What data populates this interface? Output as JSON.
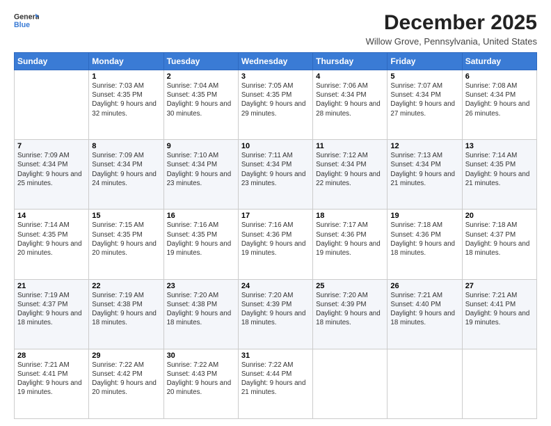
{
  "header": {
    "logo_general": "General",
    "logo_blue": "Blue",
    "month_title": "December 2025",
    "location": "Willow Grove, Pennsylvania, United States"
  },
  "days_of_week": [
    "Sunday",
    "Monday",
    "Tuesday",
    "Wednesday",
    "Thursday",
    "Friday",
    "Saturday"
  ],
  "weeks": [
    [
      {
        "day": "",
        "sunrise": "",
        "sunset": "",
        "daylight": ""
      },
      {
        "day": "1",
        "sunrise": "Sunrise: 7:03 AM",
        "sunset": "Sunset: 4:35 PM",
        "daylight": "Daylight: 9 hours and 32 minutes."
      },
      {
        "day": "2",
        "sunrise": "Sunrise: 7:04 AM",
        "sunset": "Sunset: 4:35 PM",
        "daylight": "Daylight: 9 hours and 30 minutes."
      },
      {
        "day": "3",
        "sunrise": "Sunrise: 7:05 AM",
        "sunset": "Sunset: 4:35 PM",
        "daylight": "Daylight: 9 hours and 29 minutes."
      },
      {
        "day": "4",
        "sunrise": "Sunrise: 7:06 AM",
        "sunset": "Sunset: 4:34 PM",
        "daylight": "Daylight: 9 hours and 28 minutes."
      },
      {
        "day": "5",
        "sunrise": "Sunrise: 7:07 AM",
        "sunset": "Sunset: 4:34 PM",
        "daylight": "Daylight: 9 hours and 27 minutes."
      },
      {
        "day": "6",
        "sunrise": "Sunrise: 7:08 AM",
        "sunset": "Sunset: 4:34 PM",
        "daylight": "Daylight: 9 hours and 26 minutes."
      }
    ],
    [
      {
        "day": "7",
        "sunrise": "Sunrise: 7:09 AM",
        "sunset": "Sunset: 4:34 PM",
        "daylight": "Daylight: 9 hours and 25 minutes."
      },
      {
        "day": "8",
        "sunrise": "Sunrise: 7:09 AM",
        "sunset": "Sunset: 4:34 PM",
        "daylight": "Daylight: 9 hours and 24 minutes."
      },
      {
        "day": "9",
        "sunrise": "Sunrise: 7:10 AM",
        "sunset": "Sunset: 4:34 PM",
        "daylight": "Daylight: 9 hours and 23 minutes."
      },
      {
        "day": "10",
        "sunrise": "Sunrise: 7:11 AM",
        "sunset": "Sunset: 4:34 PM",
        "daylight": "Daylight: 9 hours and 23 minutes."
      },
      {
        "day": "11",
        "sunrise": "Sunrise: 7:12 AM",
        "sunset": "Sunset: 4:34 PM",
        "daylight": "Daylight: 9 hours and 22 minutes."
      },
      {
        "day": "12",
        "sunrise": "Sunrise: 7:13 AM",
        "sunset": "Sunset: 4:34 PM",
        "daylight": "Daylight: 9 hours and 21 minutes."
      },
      {
        "day": "13",
        "sunrise": "Sunrise: 7:14 AM",
        "sunset": "Sunset: 4:35 PM",
        "daylight": "Daylight: 9 hours and 21 minutes."
      }
    ],
    [
      {
        "day": "14",
        "sunrise": "Sunrise: 7:14 AM",
        "sunset": "Sunset: 4:35 PM",
        "daylight": "Daylight: 9 hours and 20 minutes."
      },
      {
        "day": "15",
        "sunrise": "Sunrise: 7:15 AM",
        "sunset": "Sunset: 4:35 PM",
        "daylight": "Daylight: 9 hours and 20 minutes."
      },
      {
        "day": "16",
        "sunrise": "Sunrise: 7:16 AM",
        "sunset": "Sunset: 4:35 PM",
        "daylight": "Daylight: 9 hours and 19 minutes."
      },
      {
        "day": "17",
        "sunrise": "Sunrise: 7:16 AM",
        "sunset": "Sunset: 4:36 PM",
        "daylight": "Daylight: 9 hours and 19 minutes."
      },
      {
        "day": "18",
        "sunrise": "Sunrise: 7:17 AM",
        "sunset": "Sunset: 4:36 PM",
        "daylight": "Daylight: 9 hours and 19 minutes."
      },
      {
        "day": "19",
        "sunrise": "Sunrise: 7:18 AM",
        "sunset": "Sunset: 4:36 PM",
        "daylight": "Daylight: 9 hours and 18 minutes."
      },
      {
        "day": "20",
        "sunrise": "Sunrise: 7:18 AM",
        "sunset": "Sunset: 4:37 PM",
        "daylight": "Daylight: 9 hours and 18 minutes."
      }
    ],
    [
      {
        "day": "21",
        "sunrise": "Sunrise: 7:19 AM",
        "sunset": "Sunset: 4:37 PM",
        "daylight": "Daylight: 9 hours and 18 minutes."
      },
      {
        "day": "22",
        "sunrise": "Sunrise: 7:19 AM",
        "sunset": "Sunset: 4:38 PM",
        "daylight": "Daylight: 9 hours and 18 minutes."
      },
      {
        "day": "23",
        "sunrise": "Sunrise: 7:20 AM",
        "sunset": "Sunset: 4:38 PM",
        "daylight": "Daylight: 9 hours and 18 minutes."
      },
      {
        "day": "24",
        "sunrise": "Sunrise: 7:20 AM",
        "sunset": "Sunset: 4:39 PM",
        "daylight": "Daylight: 9 hours and 18 minutes."
      },
      {
        "day": "25",
        "sunrise": "Sunrise: 7:20 AM",
        "sunset": "Sunset: 4:39 PM",
        "daylight": "Daylight: 9 hours and 18 minutes."
      },
      {
        "day": "26",
        "sunrise": "Sunrise: 7:21 AM",
        "sunset": "Sunset: 4:40 PM",
        "daylight": "Daylight: 9 hours and 18 minutes."
      },
      {
        "day": "27",
        "sunrise": "Sunrise: 7:21 AM",
        "sunset": "Sunset: 4:41 PM",
        "daylight": "Daylight: 9 hours and 19 minutes."
      }
    ],
    [
      {
        "day": "28",
        "sunrise": "Sunrise: 7:21 AM",
        "sunset": "Sunset: 4:41 PM",
        "daylight": "Daylight: 9 hours and 19 minutes."
      },
      {
        "day": "29",
        "sunrise": "Sunrise: 7:22 AM",
        "sunset": "Sunset: 4:42 PM",
        "daylight": "Daylight: 9 hours and 20 minutes."
      },
      {
        "day": "30",
        "sunrise": "Sunrise: 7:22 AM",
        "sunset": "Sunset: 4:43 PM",
        "daylight": "Daylight: 9 hours and 20 minutes."
      },
      {
        "day": "31",
        "sunrise": "Sunrise: 7:22 AM",
        "sunset": "Sunset: 4:44 PM",
        "daylight": "Daylight: 9 hours and 21 minutes."
      },
      {
        "day": "",
        "sunrise": "",
        "sunset": "",
        "daylight": ""
      },
      {
        "day": "",
        "sunrise": "",
        "sunset": "",
        "daylight": ""
      },
      {
        "day": "",
        "sunrise": "",
        "sunset": "",
        "daylight": ""
      }
    ]
  ]
}
